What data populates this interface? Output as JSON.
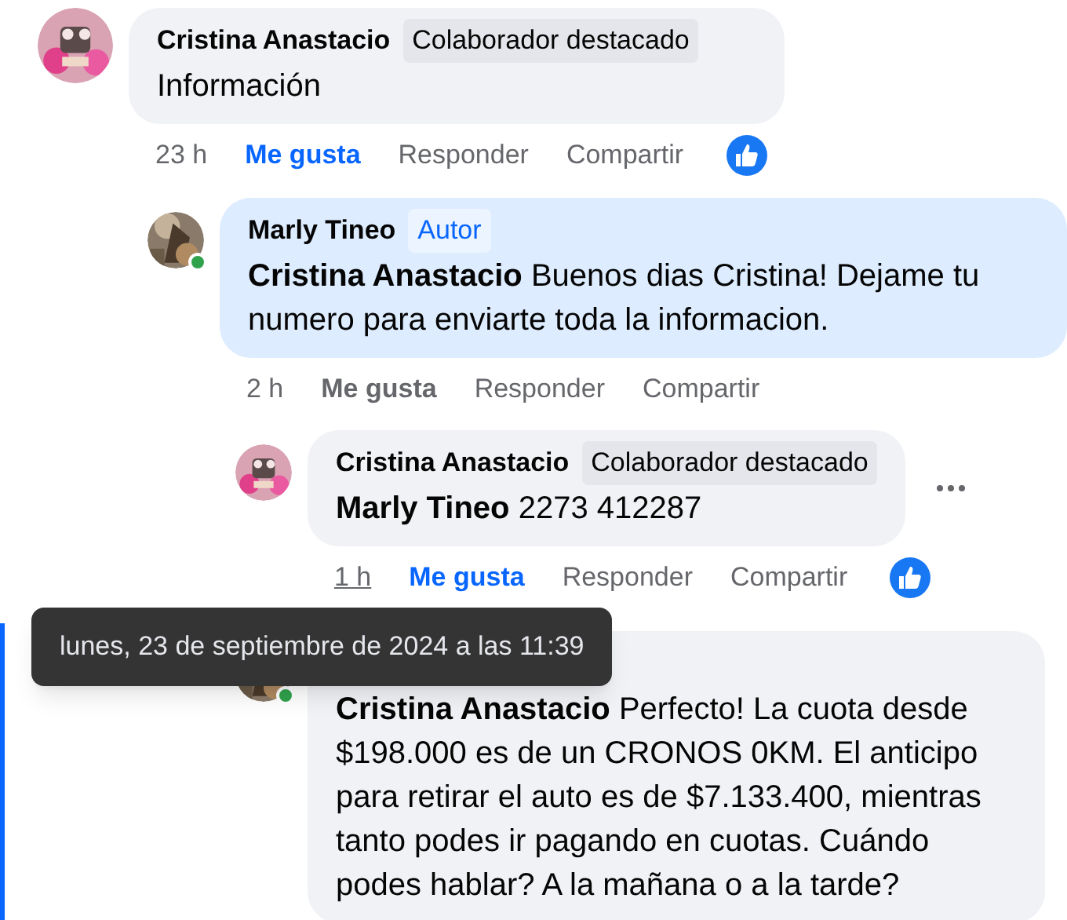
{
  "comments": [
    {
      "author": "Cristina Anastacio",
      "badge": {
        "kind": "fan",
        "text": "Colaborador destacado"
      },
      "text": "Información",
      "actions": {
        "time": "23 h",
        "like": "Me gusta",
        "reply": "Responder",
        "share": "Compartir",
        "liked": true,
        "reaction": true
      },
      "children": [
        {
          "author": "Marly Tineo",
          "badge": {
            "kind": "author",
            "text": "Autor"
          },
          "mention": "Cristina Anastacio",
          "text": "Buenos dias Cristina! Dejame tu numero para enviarte toda la informacion.",
          "online": true,
          "highlighted": true,
          "actions": {
            "time": "2 h",
            "like": "Me gusta",
            "reply": "Responder",
            "share": "Compartir",
            "liked": false
          },
          "children": [
            {
              "author": "Cristina Anastacio",
              "badge": {
                "kind": "fan",
                "text": "Colaborador destacado"
              },
              "mention": "Marly Tineo",
              "text": "2273 412287",
              "menu": true,
              "actions": {
                "time": "1 h",
                "like": "Me gusta",
                "reply": "Responder",
                "share": "Compartir",
                "liked": true,
                "reaction": true,
                "time_underlined": true
              }
            },
            {
              "mention": "Cristina Anastacio",
              "text": "Perfecto! La cuota desde $198.000 es de un CRONOS 0KM. El anticipo para retirar el auto es de $7.133.400, mientras tanto podes ir pagando en cuotas. Cuándo podes hablar? A la mañana o a la tarde?",
              "online": true,
              "focused": true
            }
          ]
        }
      ]
    }
  ],
  "tooltip": {
    "text": "lunes, 23 de septiembre de 2024 a las 11:39"
  }
}
